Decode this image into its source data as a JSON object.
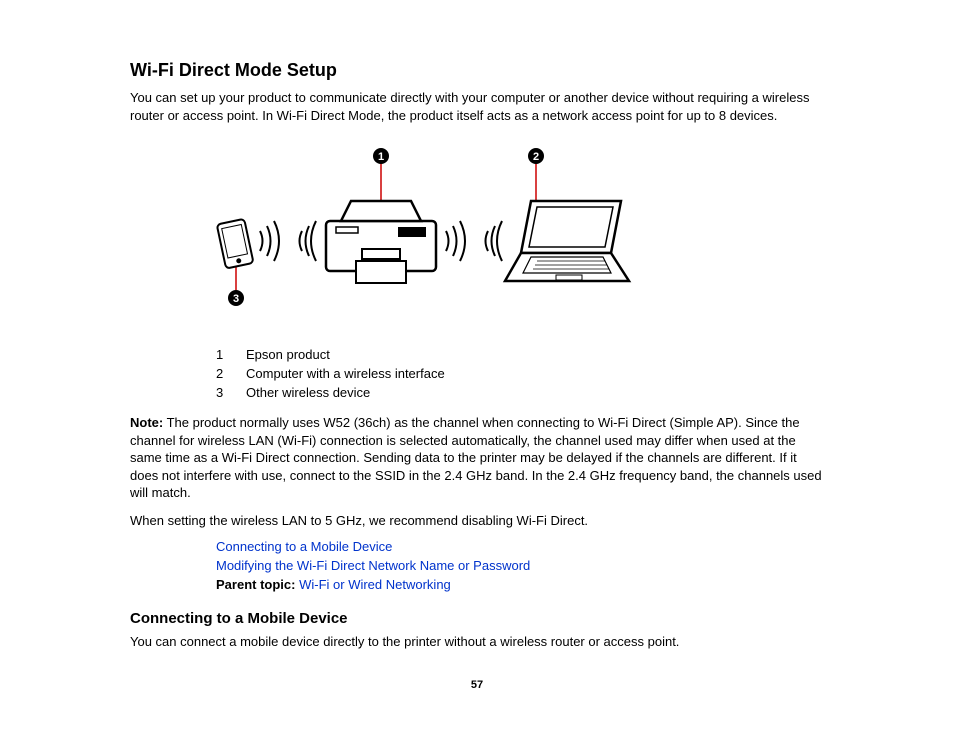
{
  "heading1": "Wi-Fi Direct Mode Setup",
  "intro": "You can set up your product to communicate directly with your computer or another device without requiring a wireless router or access point. In Wi-Fi Direct Mode, the product itself acts as a network access point for up to 8 devices.",
  "diagram": {
    "callouts": [
      "1",
      "2",
      "3"
    ]
  },
  "legend": [
    {
      "num": "1",
      "text": "Epson product"
    },
    {
      "num": "2",
      "text": "Computer with a wireless interface"
    },
    {
      "num": "3",
      "text": "Other wireless device"
    }
  ],
  "note_label": "Note:",
  "note_body": " The product normally uses W52 (36ch) as the channel when connecting to Wi-Fi Direct (Simple AP). Since the channel for wireless LAN (Wi-Fi) connection is selected automatically, the channel used may differ when used at the same time as a Wi-Fi Direct connection. Sending data to the printer may be delayed if the channels are different. If it does not interfere with use, connect to the SSID in the 2.4 GHz band. In the 2.4 GHz frequency band, the channels used will match.",
  "para2": "When setting the wireless LAN to 5 GHz, we recommend disabling Wi-Fi Direct.",
  "link1": "Connecting to a Mobile Device",
  "link2": "Modifying the Wi-Fi Direct Network Name or Password",
  "parent_label": "Parent topic:",
  "parent_link": "Wi-Fi or Wired Networking",
  "heading2": "Connecting to a Mobile Device",
  "para3": "You can connect a mobile device directly to the printer without a wireless router or access point.",
  "page_number": "57"
}
